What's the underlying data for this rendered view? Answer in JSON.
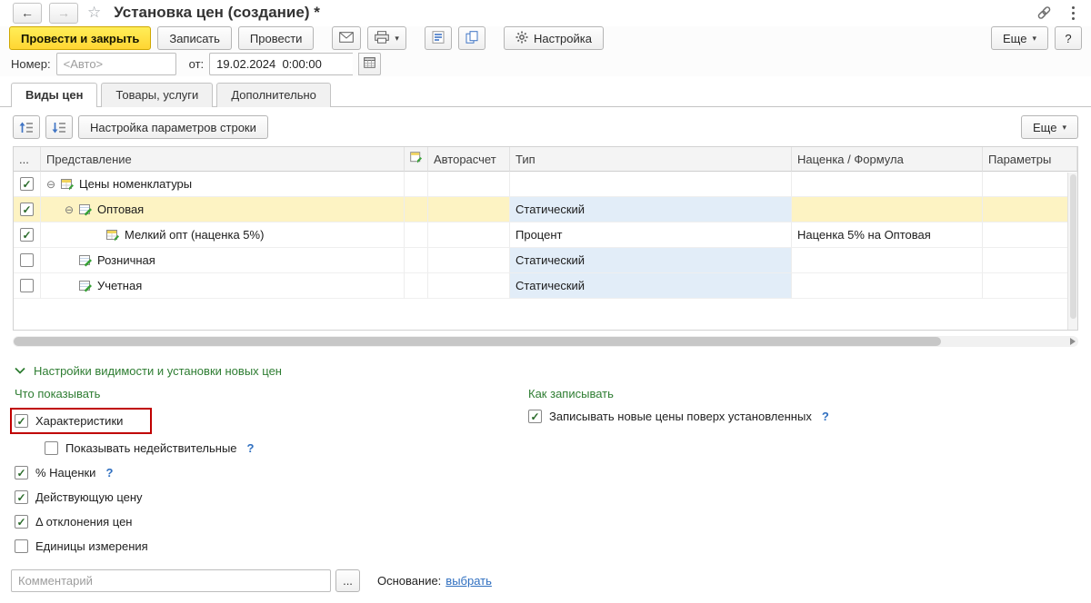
{
  "icons": {
    "back": "←",
    "forward": "→",
    "star": "☆",
    "caret": "▾"
  },
  "titlebar": {
    "title": "Установка цен (создание) *"
  },
  "toolbar": {
    "post_and_close": "Провести и закрыть",
    "write": "Записать",
    "post": "Провести",
    "settings": "Настройка",
    "more": "Еще",
    "help": "?"
  },
  "fields": {
    "number_label": "Номер:",
    "number_placeholder": "<Авто>",
    "date_label": "от:",
    "date_value": "19.02.2024  0:00:00"
  },
  "tabs": [
    {
      "label": "Виды цен"
    },
    {
      "label": "Товары, услуги"
    },
    {
      "label": "Дополнительно"
    }
  ],
  "grid_toolbar": {
    "row_settings": "Настройка параметров строки",
    "more": "Еще"
  },
  "grid": {
    "col_dots": "...",
    "col_name": "Представление",
    "col_autocalc": "Авторасчет",
    "col_type": "Тип",
    "col_formula": "Наценка / Формула",
    "col_params": "Параметры",
    "rows": [
      {
        "check": "✓",
        "expander": "⊖",
        "name": "Цены номенклатуры",
        "type": "",
        "formula": ""
      },
      {
        "check": "✓",
        "expander": "⊖",
        "name": "Оптовая",
        "type": "Статический",
        "formula": ""
      },
      {
        "check": "✓",
        "expander": "",
        "name": "Мелкий опт (наценка 5%)",
        "type": "Процент",
        "formula": "Наценка 5% на Оптовая"
      },
      {
        "check": "",
        "expander": "",
        "name": "Розничная",
        "type": "Статический",
        "formula": ""
      },
      {
        "check": "",
        "expander": "",
        "name": "Учетная",
        "type": "Статический",
        "formula": ""
      }
    ]
  },
  "settings": {
    "section_title": "Настройки видимости и установки новых цен",
    "show_title": "Что показывать",
    "write_title": "Как записывать",
    "show_items": [
      {
        "check": "✓",
        "label": "Характеристики",
        "help": ""
      },
      {
        "check": "",
        "label": "Показывать недействительные",
        "help": "?"
      },
      {
        "check": "✓",
        "label": "% Наценки",
        "help": "?"
      },
      {
        "check": "✓",
        "label": "Действующую цену",
        "help": ""
      },
      {
        "check": "✓",
        "label": "Δ отклонения цен",
        "help": ""
      },
      {
        "check": "",
        "label": "Единицы измерения",
        "help": ""
      }
    ],
    "write_items": [
      {
        "check": "✓",
        "label": "Записывать новые цены поверх установленных",
        "help": "?"
      }
    ]
  },
  "footer": {
    "comment_placeholder": "Комментарий",
    "comment_more": "...",
    "basis_label": "Основание:",
    "basis_link": "выбрать"
  }
}
